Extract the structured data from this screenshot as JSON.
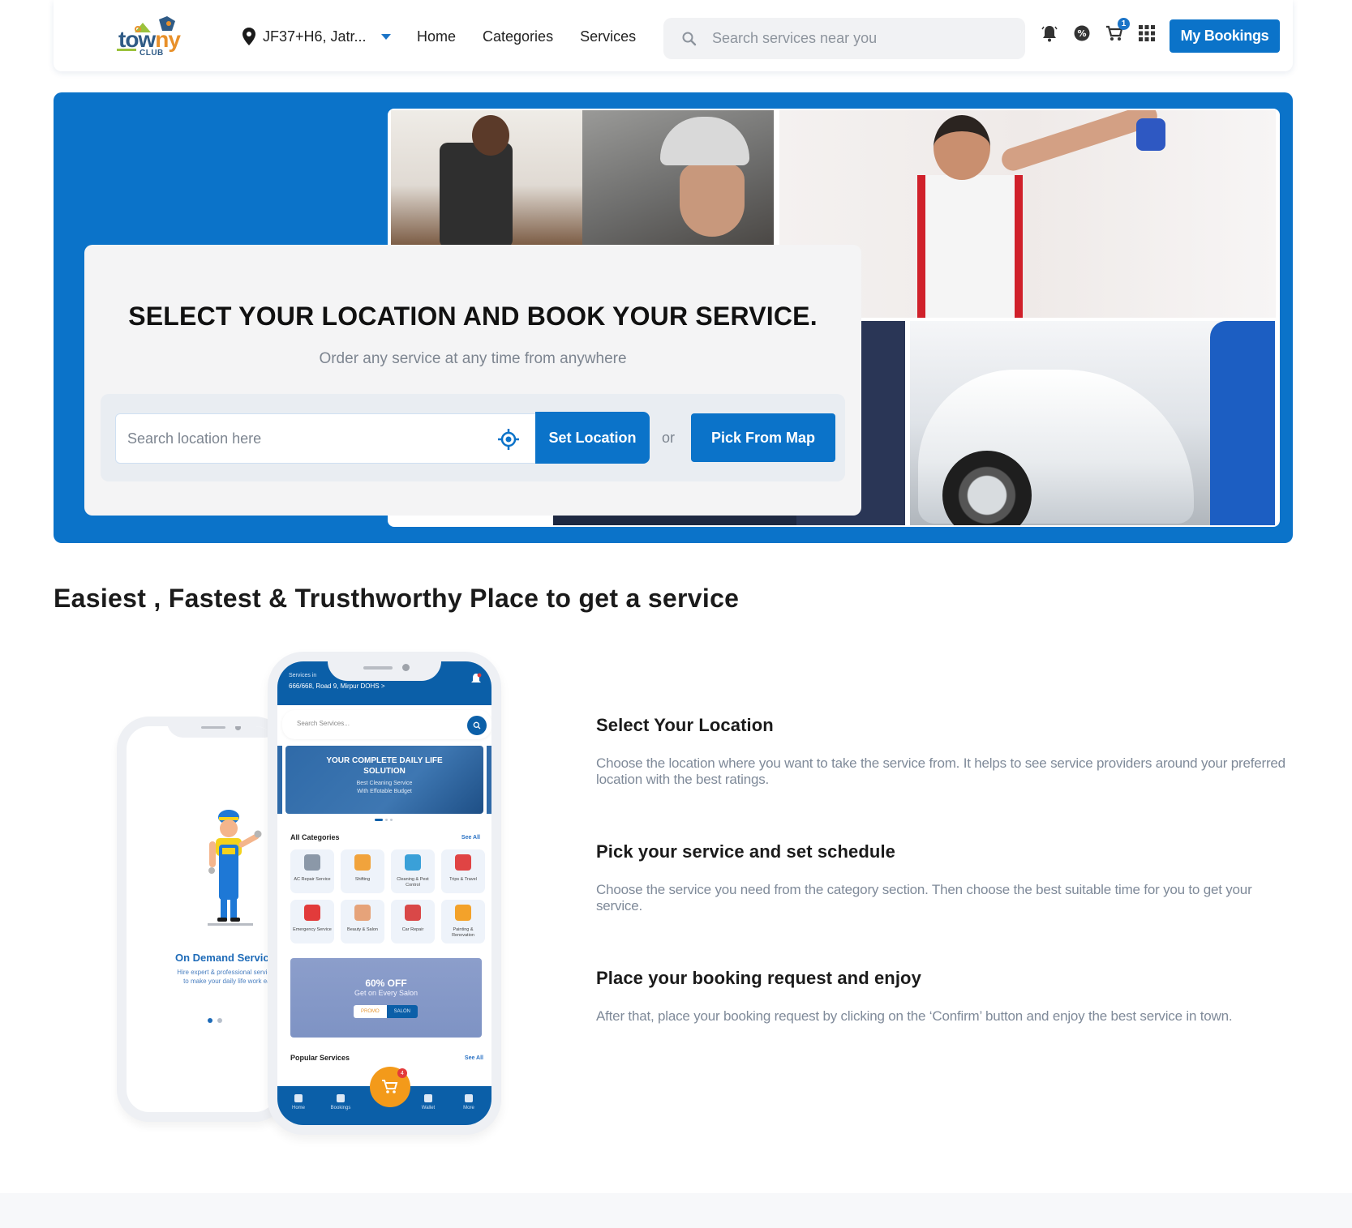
{
  "header": {
    "logo": {
      "word_part1": "tow",
      "word_part2": "ny",
      "sub": "CLUB"
    },
    "location": "JF37+H6, Jatr...",
    "nav": [
      {
        "label": "Home"
      },
      {
        "label": "Categories"
      },
      {
        "label": "Services"
      }
    ],
    "search_placeholder": "Search services near you",
    "icons": [
      "notification-bell-icon",
      "offer-percent-icon",
      "cart-icon",
      "apps-grid-icon"
    ],
    "cart_count": "1",
    "my_bookings_label": "My Bookings",
    "accent": "#0b73c9"
  },
  "hero": {
    "title": "SELECT YOUR LOCATION  AND BOOK YOUR SERVICE.",
    "subtitle": "Order any service at any time from anywhere",
    "location_placeholder": "Search location here",
    "set_location_label": "Set Location",
    "or_label": "or",
    "pick_from_map_label": "Pick From Map",
    "background": "#0b73c9"
  },
  "section": {
    "title": "Easiest , Fastest & Trusthworthy Place to get a service",
    "steps": [
      {
        "title": "Select Your Location",
        "description": "Choose the location where you want to take the service from. It helps to see service providers around your preferred location with the best ratings."
      },
      {
        "title": "Pick your service and set schedule",
        "description": "Choose the service you need from the category section. Then choose the best suitable time for you to get your service."
      },
      {
        "title": "Place your booking request and enjoy",
        "description": "After that, place your booking request by clicking on the ‘Confirm’ button and enjoy the best service in town."
      }
    ]
  },
  "phone_back": {
    "title": "On Demand Service",
    "description_line1": "Hire expert & professional service pro",
    "description_line2": "to make your daily life work easie"
  },
  "phone_front": {
    "services_in": "Services in",
    "address": "666/668, Road 9, Mirpur DOHS  >",
    "search_placeholder": "Search Services...",
    "banner_title_1": "YOUR COMPLETE DAILY LIFE",
    "banner_title_2": "SOLUTION",
    "banner_sub_1": "Best Cleaning Service",
    "banner_sub_2": "With Effotable Budget",
    "all_categories": "All Categories",
    "see_all": "See All",
    "categories": [
      {
        "label": "AC Repair Service",
        "color": "#8b98a8"
      },
      {
        "label": "Shifting",
        "color": "#f1a33c"
      },
      {
        "label": "Cleaning & Pest Control",
        "color": "#3aa0d8"
      },
      {
        "label": "Trips & Travel",
        "color": "#e04444"
      },
      {
        "label": "Emergency Service",
        "color": "#e23b3b"
      },
      {
        "label": "Beauty & Salon",
        "color": "#e6a37a"
      },
      {
        "label": "Car Repair",
        "color": "#d94848"
      },
      {
        "label": "Painting & Renovation",
        "color": "#f3a22a"
      }
    ],
    "promo_title": "60% OFF",
    "promo_sub": "Get on Every Salon",
    "promo_tag_1": "PROMO",
    "promo_tag_2": "SALON",
    "popular_services": "Popular Services",
    "popular_see_all": "See All",
    "bottom_nav": [
      "Home",
      "Bookings",
      "Wallet",
      "More"
    ],
    "cart_badge": "4"
  }
}
